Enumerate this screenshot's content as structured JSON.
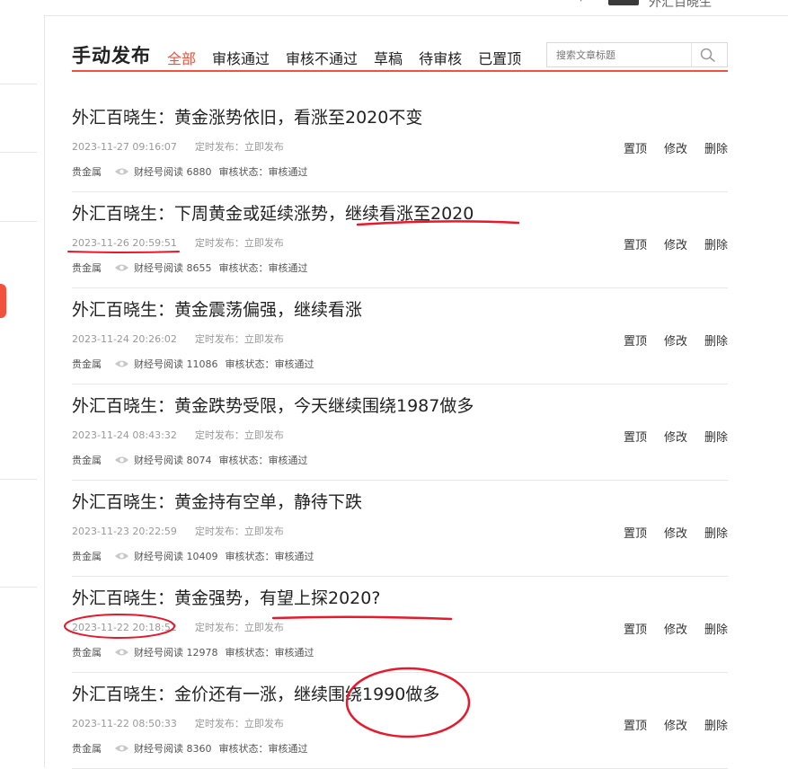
{
  "header": {
    "user_name": "外汇百晓生"
  },
  "page": {
    "title": "手动发布"
  },
  "tabs": [
    {
      "label": "全部",
      "active": true
    },
    {
      "label": "审核通过",
      "active": false
    },
    {
      "label": "审核不通过",
      "active": false
    },
    {
      "label": "草稿",
      "active": false
    },
    {
      "label": "待审核",
      "active": false
    },
    {
      "label": "已置顶",
      "active": false
    }
  ],
  "search": {
    "placeholder": "搜索文章标题",
    "icon": "search-icon"
  },
  "articles": [
    {
      "title": "外汇百晓生：黄金涨势依旧，看涨至2020不变",
      "time": "2023-11-27 09:16:07",
      "schedule": "定时发布：立即发布",
      "category": "贵金属",
      "reads": "财经号阅读 6880",
      "status": "审核状态：审核通过"
    },
    {
      "title": "外汇百晓生：下周黄金或延续涨势，继续看涨至2020",
      "time": "2023-11-26 20:59:51",
      "schedule": "定时发布：立即发布",
      "category": "贵金属",
      "reads": "财经号阅读 8655",
      "status": "审核状态：审核通过"
    },
    {
      "title": "外汇百晓生：黄金震荡偏强，继续看涨",
      "time": "2023-11-24 20:26:02",
      "schedule": "定时发布：立即发布",
      "category": "贵金属",
      "reads": "财经号阅读 11086",
      "status": "审核状态：审核通过"
    },
    {
      "title": "外汇百晓生：黄金跌势受限，今天继续围绕1987做多",
      "time": "2023-11-24 08:43:32",
      "schedule": "定时发布：立即发布",
      "category": "贵金属",
      "reads": "财经号阅读 8074",
      "status": "审核状态：审核通过"
    },
    {
      "title": "外汇百晓生：黄金持有空单，静待下跌",
      "time": "2023-11-23 20:22:59",
      "schedule": "定时发布：立即发布",
      "category": "贵金属",
      "reads": "财经号阅读 10409",
      "status": "审核状态：审核通过"
    },
    {
      "title": "外汇百晓生：黄金强势，有望上探2020?",
      "time": "2023-11-22 20:18:52",
      "schedule": "定时发布：立即发布",
      "category": "贵金属",
      "reads": "财经号阅读 12978",
      "status": "审核状态：审核通过"
    },
    {
      "title": "外汇百晓生：金价还有一涨，继续围绕1990做多",
      "time": "2023-11-22 08:50:33",
      "schedule": "定时发布：立即发布",
      "category": "贵金属",
      "reads": "财经号阅读 8360",
      "status": "审核状态：审核通过"
    }
  ],
  "actions": {
    "pin": "置顶",
    "edit": "修改",
    "delete": "删除"
  },
  "colors": {
    "accent": "#f2523b",
    "annotation": "#e8192c"
  }
}
